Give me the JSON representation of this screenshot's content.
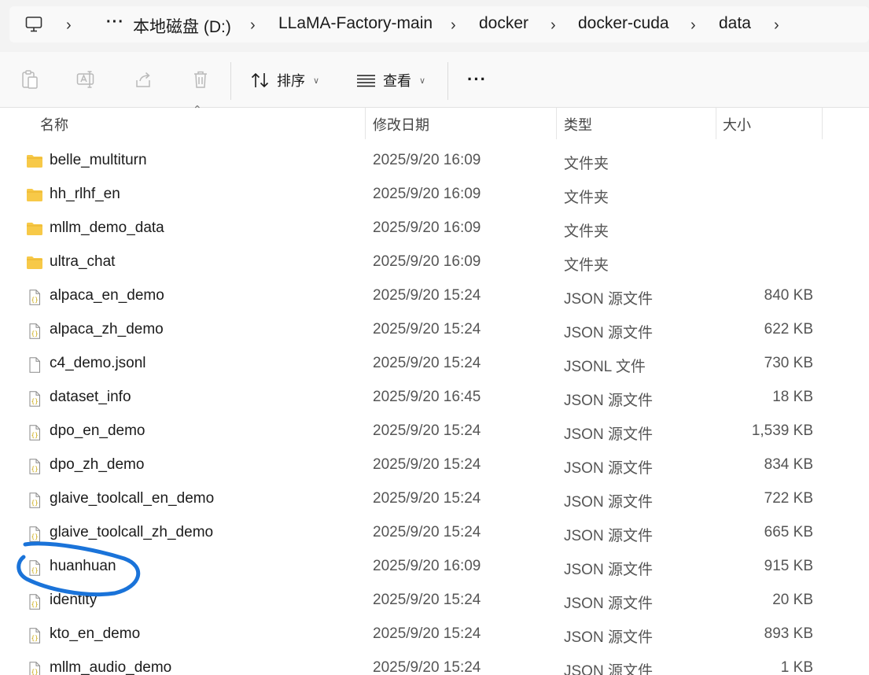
{
  "address_bar": {
    "breadcrumbs": [
      "本地磁盘 (D:)",
      "LLaMA-Factory-main",
      "docker",
      "docker-cuda",
      "data"
    ],
    "overflow_label": "···"
  },
  "toolbar": {
    "sort_label": "排序",
    "view_label": "查看",
    "more_label": "···"
  },
  "columns": {
    "name": "名称",
    "modified": "修改日期",
    "type": "类型",
    "size": "大小"
  },
  "files": [
    {
      "name": "belle_multiturn",
      "modified": "2025/9/20 16:09",
      "type": "文件夹",
      "size": "",
      "icon": "folder-icon"
    },
    {
      "name": "hh_rlhf_en",
      "modified": "2025/9/20 16:09",
      "type": "文件夹",
      "size": "",
      "icon": "folder-icon"
    },
    {
      "name": "mllm_demo_data",
      "modified": "2025/9/20 16:09",
      "type": "文件夹",
      "size": "",
      "icon": "folder-icon"
    },
    {
      "name": "ultra_chat",
      "modified": "2025/9/20 16:09",
      "type": "文件夹",
      "size": "",
      "icon": "folder-icon"
    },
    {
      "name": "alpaca_en_demo",
      "modified": "2025/9/20 15:24",
      "type": "JSON 源文件",
      "size": "840 KB",
      "icon": "json-file-icon"
    },
    {
      "name": "alpaca_zh_demo",
      "modified": "2025/9/20 15:24",
      "type": "JSON 源文件",
      "size": "622 KB",
      "icon": "json-file-icon"
    },
    {
      "name": "c4_demo.jsonl",
      "modified": "2025/9/20 15:24",
      "type": "JSONL 文件",
      "size": "730 KB",
      "icon": "file-icon"
    },
    {
      "name": "dataset_info",
      "modified": "2025/9/20 16:45",
      "type": "JSON 源文件",
      "size": "18 KB",
      "icon": "json-file-icon"
    },
    {
      "name": "dpo_en_demo",
      "modified": "2025/9/20 15:24",
      "type": "JSON 源文件",
      "size": "1,539 KB",
      "icon": "json-file-icon"
    },
    {
      "name": "dpo_zh_demo",
      "modified": "2025/9/20 15:24",
      "type": "JSON 源文件",
      "size": "834 KB",
      "icon": "json-file-icon"
    },
    {
      "name": "glaive_toolcall_en_demo",
      "modified": "2025/9/20 15:24",
      "type": "JSON 源文件",
      "size": "722 KB",
      "icon": "json-file-icon"
    },
    {
      "name": "glaive_toolcall_zh_demo",
      "modified": "2025/9/20 15:24",
      "type": "JSON 源文件",
      "size": "665 KB",
      "icon": "json-file-icon"
    },
    {
      "name": "huanhuan",
      "modified": "2025/9/20 16:09",
      "type": "JSON 源文件",
      "size": "915 KB",
      "icon": "json-file-icon"
    },
    {
      "name": "identity",
      "modified": "2025/9/20 15:24",
      "type": "JSON 源文件",
      "size": "20 KB",
      "icon": "json-file-icon"
    },
    {
      "name": "kto_en_demo",
      "modified": "2025/9/20 15:24",
      "type": "JSON 源文件",
      "size": "893 KB",
      "icon": "json-file-icon"
    },
    {
      "name": "mllm_audio_demo",
      "modified": "2025/9/20 15:24",
      "type": "JSON 源文件",
      "size": "1 KB",
      "icon": "json-file-icon"
    }
  ],
  "colors": {
    "folder": "#f7c948",
    "annotation": "#1a73d9"
  }
}
